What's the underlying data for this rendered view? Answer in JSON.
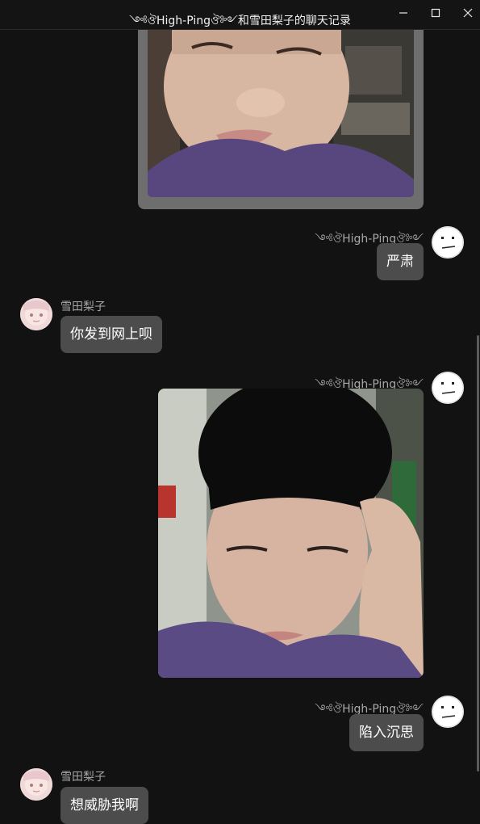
{
  "window": {
    "title": "༺ঔHigh-Pingঔ༻和雪田梨子的聊天记录",
    "minimize_icon": "minimize-icon",
    "maximize_icon": "maximize-icon",
    "close_icon": "close-icon"
  },
  "messages": [
    {
      "type": "image",
      "from": "me",
      "image": "video-call-photo"
    },
    {
      "type": "text",
      "from": "me",
      "sender": "༺ঔHigh-Pingঔ༻",
      "text": "严肃"
    },
    {
      "type": "text",
      "from": "other",
      "sender": "雪田梨子",
      "text": "你发到网上呗"
    },
    {
      "type": "image",
      "from": "me",
      "sender": "༺ঔHigh-Pingঔ༻",
      "image": "selfie-photo"
    },
    {
      "type": "text",
      "from": "me",
      "sender": "༺ঔHigh-Pingঔ༻",
      "text": "陷入沉思"
    },
    {
      "type": "text",
      "from": "other",
      "sender": "雪田梨子",
      "text": "想威胁我啊"
    }
  ],
  "colors": {
    "background": "#121212",
    "bubble": "#4c4c4c",
    "name_text": "#a8a8a8",
    "image_frame": "#6e6e6e"
  }
}
